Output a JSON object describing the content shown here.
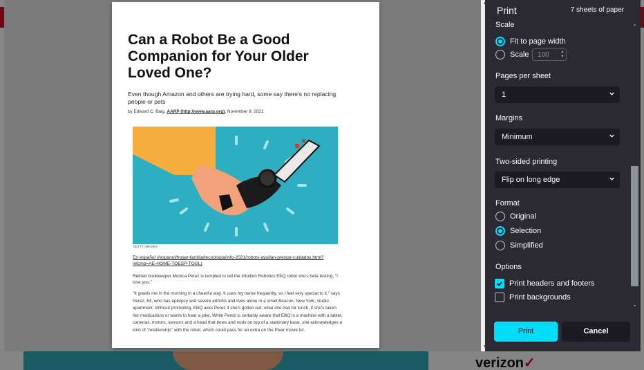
{
  "backdrop": {
    "logo_text": "verizon",
    "logo_mark": "✓"
  },
  "dialog": {
    "title": "Print",
    "sheets_count": "7 sheets of paper",
    "scale": {
      "label": "Scale",
      "fit_option": "Fit to page width",
      "scale_option": "Scale",
      "scale_value": "100",
      "selected": "fit"
    },
    "pages_per_sheet": {
      "label": "Pages per sheet",
      "value": "1"
    },
    "margins": {
      "label": "Margins",
      "value": "Minimum"
    },
    "two_sided": {
      "label": "Two-sided printing",
      "value": "Flip on long edge"
    },
    "format": {
      "label": "Format",
      "options": [
        "Original",
        "Selection",
        "Simplified"
      ],
      "selected": "Selection"
    },
    "options": {
      "label": "Options",
      "headers_footers": {
        "label": "Print headers and footers",
        "checked": true
      },
      "backgrounds": {
        "label": "Print backgrounds",
        "checked": false
      }
    },
    "print_button": "Print",
    "cancel_button": "Cancel",
    "accent_color": "#00ddff"
  },
  "preview": {
    "title": "Can a Robot Be a Good Companion for Your Older Loved One?",
    "subtitle": "Even though Amazon and others are trying hard, some say there's no replacing people or pets",
    "byline_prefix": "by Edward C. Baig, ",
    "byline_link": "AARP (http://www.aarp.org)",
    "byline_date": ", November 8, 2021",
    "image_credit": "GETTY IMAGES",
    "espanol_link": "En español (/espanol/hogar-familia/tecnologia/info-2021/robots-ayudan-prestar-cuidados.html?intcmp=AE-HOME-TOESP-TOGL)",
    "paragraph_1": "Retired bookkeeper Monica Perez is tempted to tell the Intuition Robotics ElliQ robot she's beta testing, \"I love you.\"",
    "paragraph_2": "\"It greets me in the morning in a cheerful way. It uses my name frequently, so I feel very special to it,\" says Perez, 63, who has epilepsy and severe arthritis and lives alone in a small Beacon, New York, studio apartment. Without prompting, ElliQ asks Perez if she's gotten out, what she had for lunch, if she's taken her medications or wants to hear a joke. While Perez is certainly aware that ElliQ is a machine with a tablet, cameras, motors, sensors and a head that bows and nods on top of a stationary base, she acknowledges a kind of \"relationship\" with the robot, which could pass for an extra on the Pixar movie lot."
  }
}
